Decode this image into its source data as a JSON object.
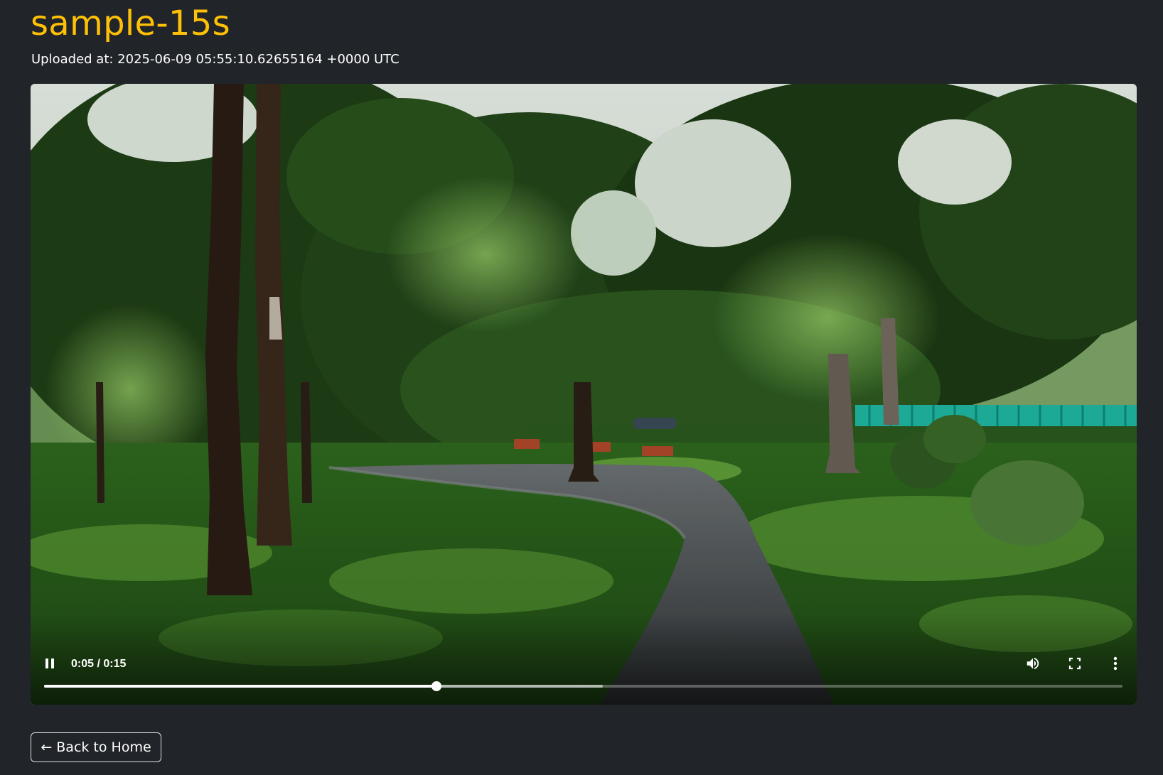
{
  "page": {
    "title": "sample-15s",
    "uploaded_at": "Uploaded at: 2025-06-09 05:55:10.62655164 +0000 UTC"
  },
  "player": {
    "scene": "park-path-with-trees",
    "time_display": "0:05 / 0:15",
    "played_fraction": 0.364,
    "buffered_fraction": 0.518,
    "state": "playing",
    "icons": {
      "play_pause": "pause-icon",
      "volume": "volume-icon",
      "fullscreen": "fullscreen-icon",
      "more": "more-options-icon"
    }
  },
  "actions": {
    "back_arrow": "←",
    "back_label": "Back to Home"
  },
  "colors": {
    "background": "#212529",
    "title": "#ffc107",
    "text": "#ffffff",
    "button_border": "#dee2e6"
  }
}
